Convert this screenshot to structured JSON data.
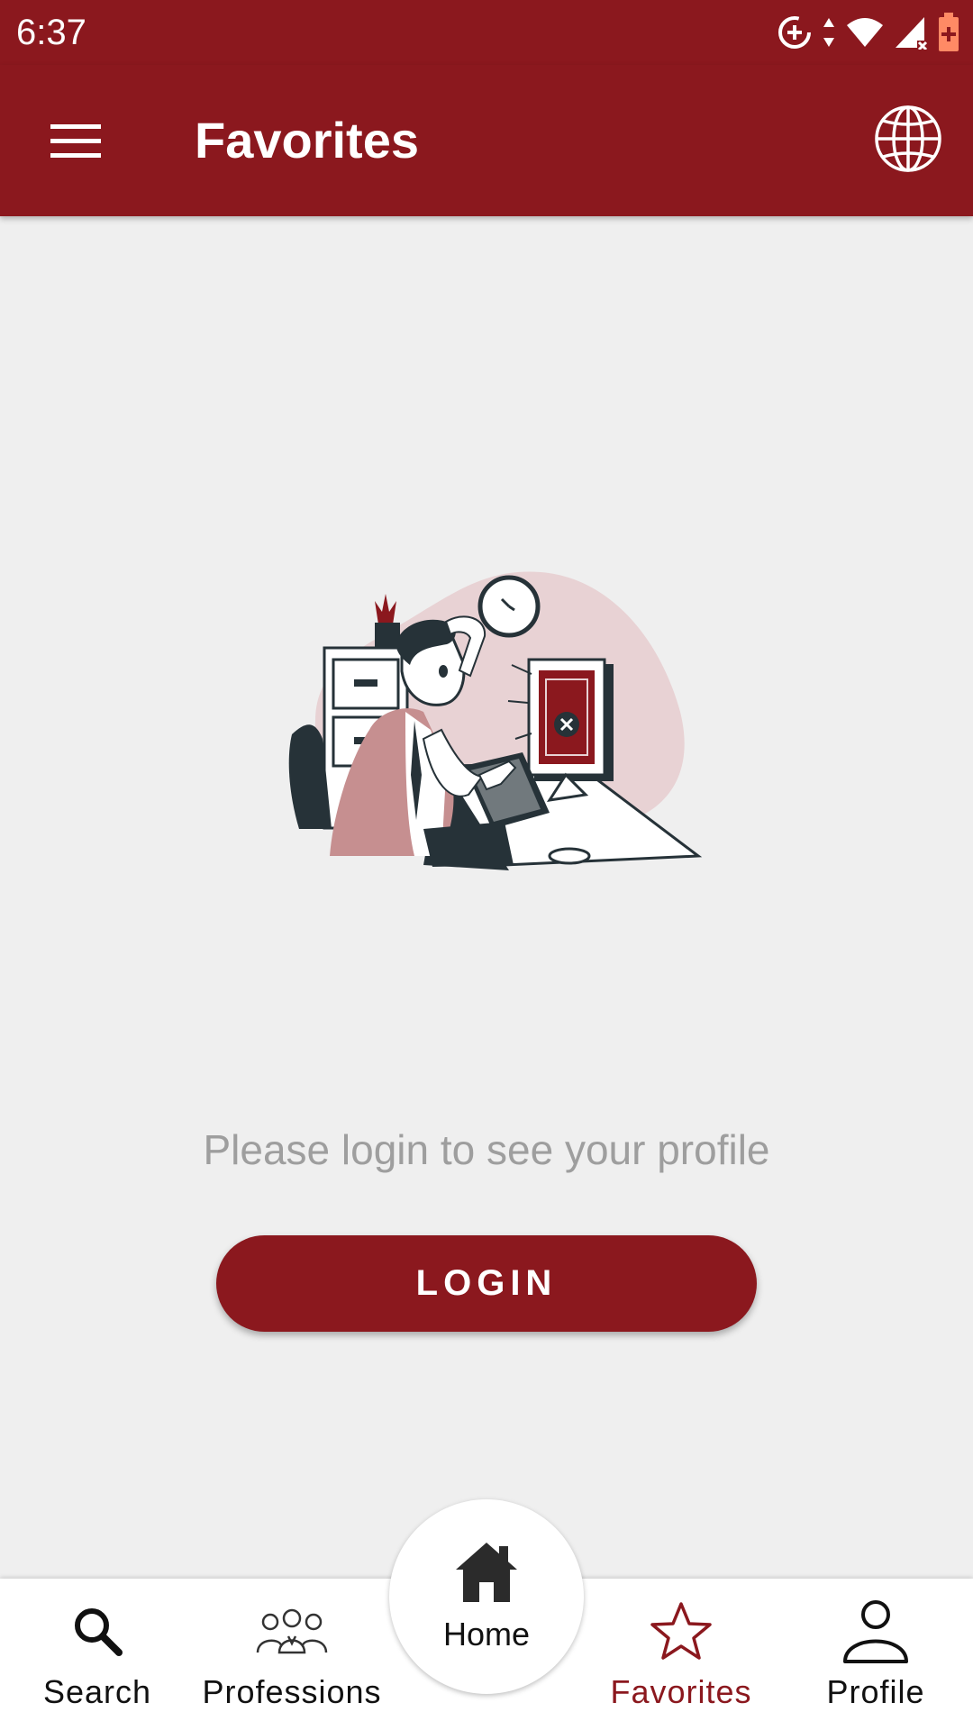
{
  "status_bar": {
    "time": "6:37"
  },
  "app_bar": {
    "title": "Favorites",
    "menu_icon": "hamburger-menu-icon",
    "language_icon": "globe-icon"
  },
  "content": {
    "message": "Please login to see your profile",
    "login_button": "LOGIN"
  },
  "bottom_nav": {
    "items": [
      {
        "label": "Search",
        "icon": "search-icon",
        "active": false
      },
      {
        "label": "Professions",
        "icon": "people-group-icon",
        "active": false
      },
      {
        "label": "Home",
        "icon": "home-icon",
        "active": false
      },
      {
        "label": "Favorites",
        "icon": "star-icon",
        "active": true
      },
      {
        "label": "Profile",
        "icon": "person-icon",
        "active": false
      }
    ]
  },
  "colors": {
    "primary": "#8b181e",
    "background": "#efefef",
    "message_text": "#9e9e9e"
  }
}
